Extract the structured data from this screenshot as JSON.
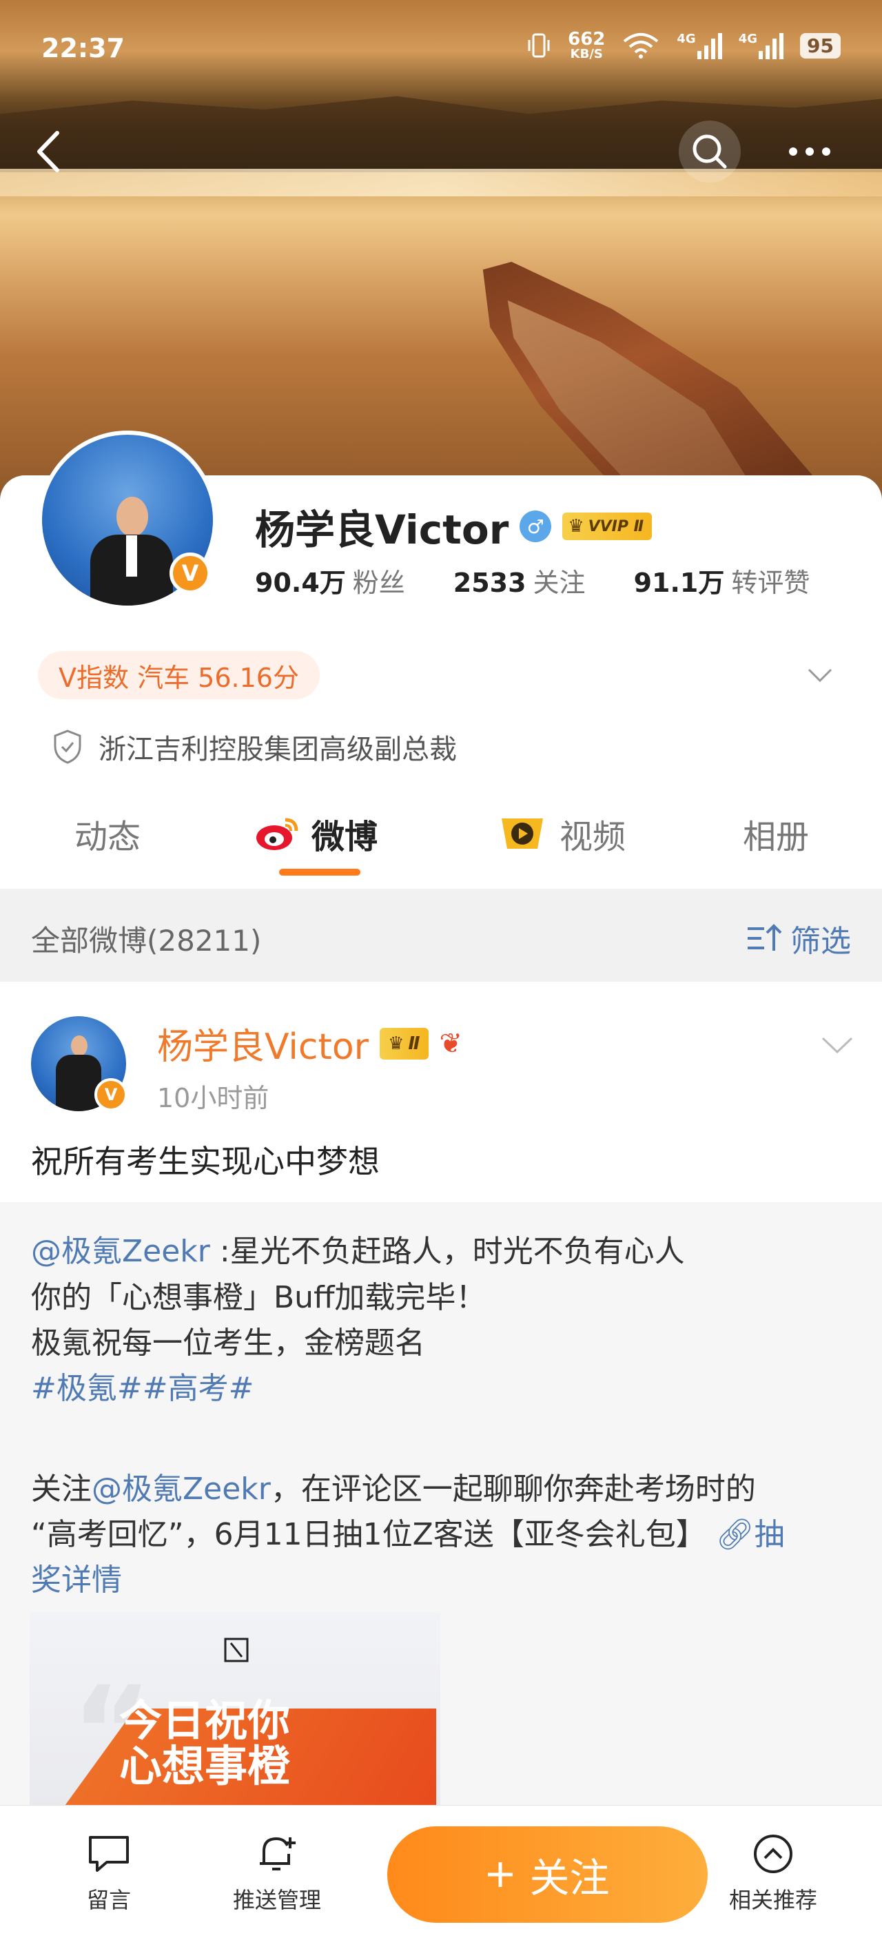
{
  "status_bar": {
    "time": "22:37",
    "net_speed": "662",
    "net_unit": "KB/S",
    "net_type_1": "4G",
    "net_type_2": "4G",
    "battery": "95"
  },
  "profile": {
    "name": "杨学良Victor",
    "vip_label": "VVIP Ⅱ",
    "stats": [
      {
        "num": "90.4万",
        "label": "粉丝"
      },
      {
        "num": "2533",
        "label": "关注"
      },
      {
        "num": "91.1万",
        "label": "转评赞"
      }
    ],
    "v_index": "V指数 汽车 56.16分",
    "certification": "浙江吉利控股集团高级副总裁"
  },
  "tabs": [
    {
      "label": "动态"
    },
    {
      "label": "微博"
    },
    {
      "label": "视频"
    },
    {
      "label": "相册"
    }
  ],
  "filter": {
    "all_label": "全部微博(28211)",
    "filter_label": "筛选"
  },
  "post": {
    "author": "杨学良Victor",
    "vip_label": "Ⅱ",
    "time": "10小时前",
    "text": "祝所有考生实现心中梦想",
    "repost": {
      "mention": "@极氪Zeekr",
      "line1_rest": " :星光不负赶路人，时光不负有心人",
      "line2": "你的「心想事橙」Buff加载完毕！",
      "line3": "极氪祝每一位考生，金榜题名",
      "hashtags": "#极氪##高考#",
      "line5_pre": "关注",
      "line5_mention": "@极氪Zeekr",
      "line5_rest": "，在评论区一起聊聊你奔赴考场时的",
      "line6": "“高考回忆”，6月11日抽1位Z客送【亚冬会礼包】",
      "lottery_a": "抽",
      "lottery_b": "奖详情",
      "image_text_1": "今日祝你",
      "image_text_2": "心想事橙"
    }
  },
  "bottom_bar": {
    "message": "留言",
    "push": "推送管理",
    "follow": "关注",
    "related": "相关推荐"
  }
}
